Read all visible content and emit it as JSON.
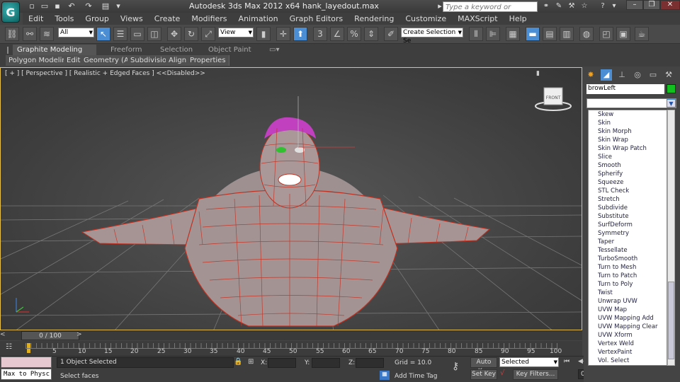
{
  "app": {
    "logo": "G",
    "title": "Autodesk 3ds Max  2012 x64    hank_layedout.max",
    "search_placeholder": "Type a keyword or phrase"
  },
  "menu": [
    "Edit",
    "Tools",
    "Group",
    "Views",
    "Create",
    "Modifiers",
    "Animation",
    "Graph Editors",
    "Rendering",
    "Customize",
    "MAXScript",
    "Help"
  ],
  "toolbar": {
    "selection_filter": "All",
    "ref_coord": "View",
    "named_selection": "Create Selection Se"
  },
  "ribbon": {
    "tabs": [
      "Graphite Modeling Tools",
      "Freeform",
      "Selection",
      "Object Paint"
    ],
    "subtabs": [
      "Polygon Modeling",
      "Edit",
      "Geometry (All)",
      "Subdivision",
      "Align",
      "Properties"
    ]
  },
  "viewport": {
    "label": "[ + ] [ Perspective ] [ Realistic + Edged Faces ] <<Disabled>>",
    "viewcube_face": "FRONT"
  },
  "timeline": {
    "slider_value": "0 / 100",
    "ticks": [
      "5",
      "10",
      "15",
      "20",
      "25",
      "30",
      "35",
      "40",
      "45",
      "50",
      "55",
      "60",
      "65",
      "70",
      "75",
      "80",
      "85",
      "90",
      "95",
      "100"
    ]
  },
  "status": {
    "maxscript_listener": "Max to Physc",
    "selection": "1 Object Selected",
    "prompt": "Select faces",
    "x_label": "X:",
    "y_label": "Y:",
    "z_label": "Z:",
    "grid": "Grid = 10.0",
    "add_time_tag": "Add Time Tag",
    "auto_key": "Auto Key",
    "set_key": "Set Key",
    "key_filter_value": "Selected",
    "key_filters": "Key Filters...",
    "frame": "0"
  },
  "command_panel": {
    "object_name": "browLeft",
    "object_color": "#12c020",
    "modifier_list": [
      "Skew",
      "Skin",
      "Skin Morph",
      "Skin Wrap",
      "Skin Wrap Patch",
      "Slice",
      "Smooth",
      "Spherify",
      "Squeeze",
      "STL Check",
      "Stretch",
      "Subdivide",
      "Substitute",
      "SurfDeform",
      "Symmetry",
      "Taper",
      "Tessellate",
      "TurboSmooth",
      "Turn to Mesh",
      "Turn to Patch",
      "Turn to Poly",
      "Twist",
      "Unwrap UVW",
      "UVW Map",
      "UVW Mapping Add",
      "UVW Mapping Clear",
      "UVW Xform",
      "Vertex Weld",
      "VertexPaint",
      "Vol. Select"
    ]
  }
}
